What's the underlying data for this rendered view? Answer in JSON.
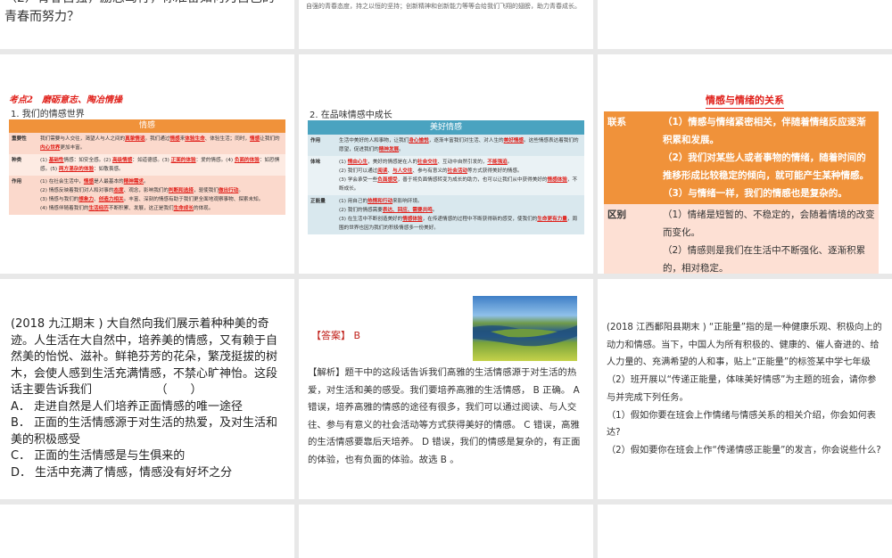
{
  "slides": {
    "s1": {
      "text": "（2）青春自强，励志笃行，你准备如何为自己的青春而努力？"
    },
    "s2": {
      "text": "自强的青春态度，持之以恒的坚持；创新精神和创新能力等等会给我们飞翔的翅膀，助力青春成长。"
    },
    "s4": {
      "heading": "考点2　磨砺意志、陶冶情操",
      "subtitle": "1. 我们的情感世界",
      "table_header": "情感",
      "rows": [
        {
          "label": "重要性",
          "segs": [
            [
              "我们需要与人交往，渴望人与人之间的",
              0
            ],
            [
              "真挚情谊",
              1
            ],
            [
              "。我们通过",
              0
            ],
            [
              "情感",
              1
            ],
            [
              "来",
              0
            ],
            [
              "体验生命",
              1
            ],
            [
              "、体验生活；同时，",
              0
            ],
            [
              "情感",
              1
            ],
            [
              "让我们的",
              0
            ],
            [
              "内心世界",
              1
            ],
            [
              "更加丰富。",
              0
            ]
          ]
        },
        {
          "label": "种类",
          "segs": [
            [
              "(1) ",
              0
            ],
            [
              "基础性",
              1
            ],
            [
              "情感：如安全感。(2) ",
              0
            ],
            [
              "高级情感",
              1
            ],
            [
              "：如道德感。(3) ",
              0
            ],
            [
              "正面的体验",
              1
            ],
            [
              "：爱的情感。(4) ",
              0
            ],
            [
              "负面的体验",
              1
            ],
            [
              "：如恐惧感。(5) ",
              0
            ],
            [
              "两方混杂的体验",
              1
            ],
            [
              "：如敬畏感。",
              0
            ]
          ]
        },
        {
          "label": "作用",
          "segs": [
            [
              "(1) 在社会生活中，",
              0
            ],
            [
              "情感",
              1
            ],
            [
              "是人最基本的",
              0
            ],
            [
              "精神需求",
              1
            ],
            [
              "。\n(2) 情感反映着我们对人和对事的",
              0
            ],
            [
              "态度",
              1
            ],
            [
              "、观念，影响我们的",
              0
            ],
            [
              "判断和选择",
              1
            ],
            [
              "，驱使我们",
              0
            ],
            [
              "做出行动",
              1
            ],
            [
              "。\n(3) 情感与我们的",
              0
            ],
            [
              "想象力",
              1
            ],
            [
              "、",
              0
            ],
            [
              "创造力相关",
              1
            ],
            [
              "。丰富、深刻的情感有助于我们更全面地观察事物、探索未知。\n(4) 情感伴随着我们的",
              0
            ],
            [
              "生活经历",
              1
            ],
            [
              "不断积累、发展，这正是我们",
              0
            ],
            [
              "生命成长",
              1
            ],
            [
              "的体现。",
              0
            ]
          ]
        }
      ]
    },
    "s5": {
      "subtitle": "2. 在品味情感中成长",
      "table_header": "美好情感",
      "rows": [
        {
          "label": "作用",
          "segs": [
            [
              "生活中美好的人和事物，让我们",
              0
            ],
            [
              "身心愉悦",
              1
            ],
            [
              "，逐渐丰富我们对生活、对人生的",
              0
            ],
            [
              "美好情感",
              1
            ],
            [
              "。这些情感表达着我们的愿望，促进我们的",
              0
            ],
            [
              "精神发展",
              1
            ],
            [
              "。",
              0
            ]
          ]
        },
        {
          "label": "体味",
          "segs": [
            [
              "(1) ",
              0
            ],
            [
              "情由心生",
              1
            ],
            [
              "，美好的情感是在人的",
              0
            ],
            [
              "社会交往",
              1
            ],
            [
              "、互动中自然引发的，",
              0
            ],
            [
              "不能强迫",
              1
            ],
            [
              "。\n(2) 我们可以通过",
              0
            ],
            [
              "阅读",
              1
            ],
            [
              "、",
              0
            ],
            [
              "与人交往",
              1
            ],
            [
              "、参与有意义的",
              0
            ],
            [
              "社会活动",
              1
            ],
            [
              "等方式获得美好的情感。\n(3) 学会承受一些",
              0
            ],
            [
              "负面感受",
              1
            ],
            [
              "，善于将负面情感转变为成长的助力，也可以让我们从中获得美好的",
              0
            ],
            [
              "情感体验",
              1
            ],
            [
              "，不断成长。",
              0
            ]
          ]
        },
        {
          "label": "正能量",
          "segs": [
            [
              "(1) 用自己的",
              0
            ],
            [
              "热情和行动",
              1
            ],
            [
              "来影响环境。\n(2) 我们的情感需要",
              0
            ],
            [
              "表达、回应、需要共鸣",
              1
            ],
            [
              "。\n(3) 在生活中不断创造美好的",
              0
            ],
            [
              "情感体验",
              1
            ],
            [
              "，在传递情感的过程中不断获得新的感受，使我们的",
              0
            ],
            [
              "生命更有力量",
              1
            ],
            [
              "，周围的世界也因为我们的积极情感多一份美好。",
              0
            ]
          ]
        }
      ]
    },
    "s6": {
      "title": "情感与情绪的关系",
      "rows": [
        {
          "label": "联系",
          "text": "（1）情感与情绪紧密相关，伴随着情绪反应逐渐积累和发展。\n（2）我们对某些人或者事物的情绪，随着时间的推移形成比较稳定的倾向，就可能产生某种情感。（3）与情绪一样，我们的情感也是复杂的。"
        },
        {
          "label": "区别",
          "text": "（1）情绪是短暂的、不稳定的，会随着情境的改变而变化。\n（2）情感则是我们在生活中不断强化、逐渐积累的，相对稳定。"
        }
      ]
    },
    "s7": {
      "question": "(2018 九江期末 ) 大自然向我们展示着种种美的奇迹。人生活在大自然中，培养美的情感，又有赖于自然美的怡悦、滋补。鲜艳芬芳的花朵，繁茂挺拔的树木，会使人感到生活充满情感，不禁心旷神怡。这段话主要告诉我们　　　　　　（　　）",
      "options": [
        "A．  走进自然是人们培养正面情感的唯一途径",
        "B．  正面的生活情感源于对生活的热爱，及对生活和美的积极感受",
        "C．  正面的生活情感是与生俱来的",
        "D．  生活中充满了情感，情感没有好坏之分"
      ]
    },
    "s8": {
      "answer_label": "【答案】",
      "answer": "B",
      "analysis": "【解析】题干中的这段话告诉我们高雅的生活情感源于对生活的热爱，对生活和美的感受。我们要培养高雅的生活情感， B 正确。 A 错误，培养高雅的情感的途径有很多，我们可以通过阅读、与人交往、参与有意义的社会活动等方式获得美好的情感。 C 错误，高雅的生活情感要靠后天培养。 D 错误，我们的情感是复杂的，有正面的体验，也有负面的体验。故选 B 。"
    },
    "s9": {
      "question": "(2018 江西鄱阳县期末 ) “正能量”指的是一种健康乐观、积极向上的动力和情感。当下，中国人为所有积极的、健康的、催人奋进的、给人力量的、充满希望的人和事，贴上“正能量”的标签某中学七年级（2）班开展以“传递正能量，体味美好情感”为主题的班会，请你参与并完成下列任务。",
      "q1": "（1）假如你要在班会上作情绪与情感关系的相关介绍，你会如何表达?",
      "q2": "（2）假如要你在班会上作“传递情感正能量”的发言，你会说些什么?"
    }
  },
  "colors": {
    "orange": "#f0923a",
    "teal": "#4aa3c0",
    "red": "#e0201a",
    "gap": "#e8e8e8"
  }
}
